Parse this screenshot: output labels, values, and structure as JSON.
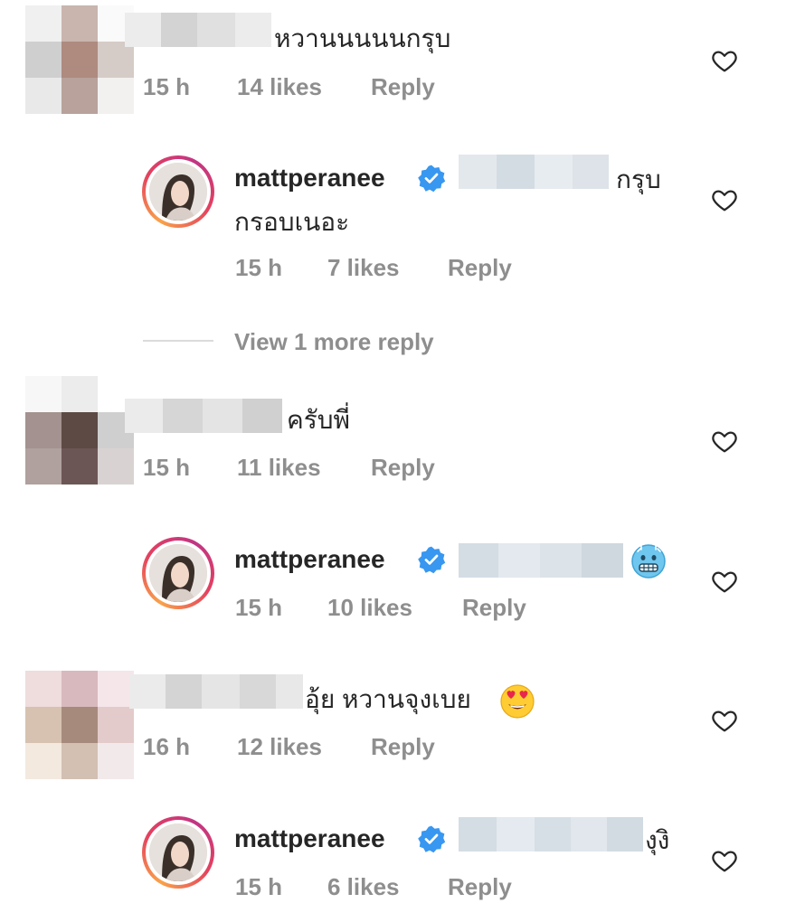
{
  "comments": [
    {
      "text": "หวานนนนนกรุบ",
      "time": "15 h",
      "likes": "14 likes",
      "reply": "Reply",
      "reply_item": {
        "username": "mattperanee",
        "text_line1": "กรุบ",
        "text_line2": "กรอบเนอะ",
        "time": "15 h",
        "likes": "7 likes",
        "reply": "Reply"
      },
      "view_more": "View 1 more reply"
    },
    {
      "text": "ครับพี่",
      "time": "15 h",
      "likes": "11 likes",
      "reply": "Reply",
      "reply_item": {
        "username": "mattperanee",
        "emoji": "cold-face-emoji",
        "time": "15 h",
        "likes": "10 likes",
        "reply": "Reply"
      }
    },
    {
      "text": "อุ้ย หวานจุงเบย",
      "emoji": "heart-eyes-emoji",
      "time": "16 h",
      "likes": "12 likes",
      "reply": "Reply",
      "reply_item": {
        "username": "mattperanee",
        "text": "งุงิ",
        "time": "15 h",
        "likes": "6 likes",
        "reply": "Reply"
      }
    }
  ],
  "colors": {
    "text": "#262626",
    "meta": "#8e8e8e",
    "verified": "#3897f0",
    "divider": "#dbdbdb"
  },
  "icons": {
    "like": "heart-icon",
    "verified": "verified-badge-icon"
  }
}
